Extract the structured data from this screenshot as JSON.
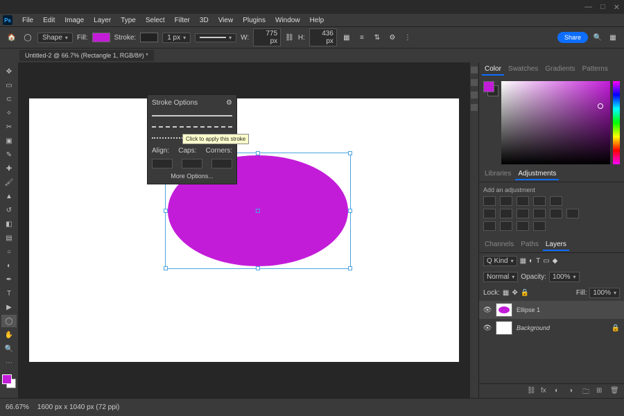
{
  "titlebar": {
    "min": "—",
    "max": "□",
    "close": "✕"
  },
  "menu": [
    "File",
    "Edit",
    "Image",
    "Layer",
    "Type",
    "Select",
    "Filter",
    "3D",
    "View",
    "Plugins",
    "Window",
    "Help"
  ],
  "options": {
    "shape_label": "Shape",
    "fill_label": "Fill:",
    "stroke_label": "Stroke:",
    "stroke_width": "1 px",
    "w_label": "W:",
    "w_value": "775 px",
    "link": "⛓",
    "h_label": "H:",
    "h_value": "436 px",
    "share": "Share"
  },
  "tab": "Untitled-2 @ 66.7% (Rectangle 1, RGB/8#) *",
  "stroke_popup": {
    "title": "Stroke Options",
    "gear": "⚙",
    "tooltip": "Click to apply this stroke",
    "align": "Align:",
    "caps": "Caps:",
    "corners": "Corners:",
    "more": "More Options..."
  },
  "panels": {
    "color_tabs": [
      "Color",
      "Swatches",
      "Gradients",
      "Patterns"
    ],
    "lib_tabs": [
      "Libraries",
      "Adjustments"
    ],
    "adj_title": "Add an adjustment",
    "layer_tabs": [
      "Channels",
      "Paths",
      "Layers"
    ],
    "kind": "Q Kind",
    "blend": "Normal",
    "opacity_label": "Opacity:",
    "opacity": "100%",
    "lock": "Lock:",
    "fill_label": "Fill:",
    "fill": "100%",
    "layer1": "Ellipse 1",
    "layer2": "Background"
  },
  "status": {
    "zoom": "66.67%",
    "info": "1600 px x 1040 px (72 ppi)"
  }
}
